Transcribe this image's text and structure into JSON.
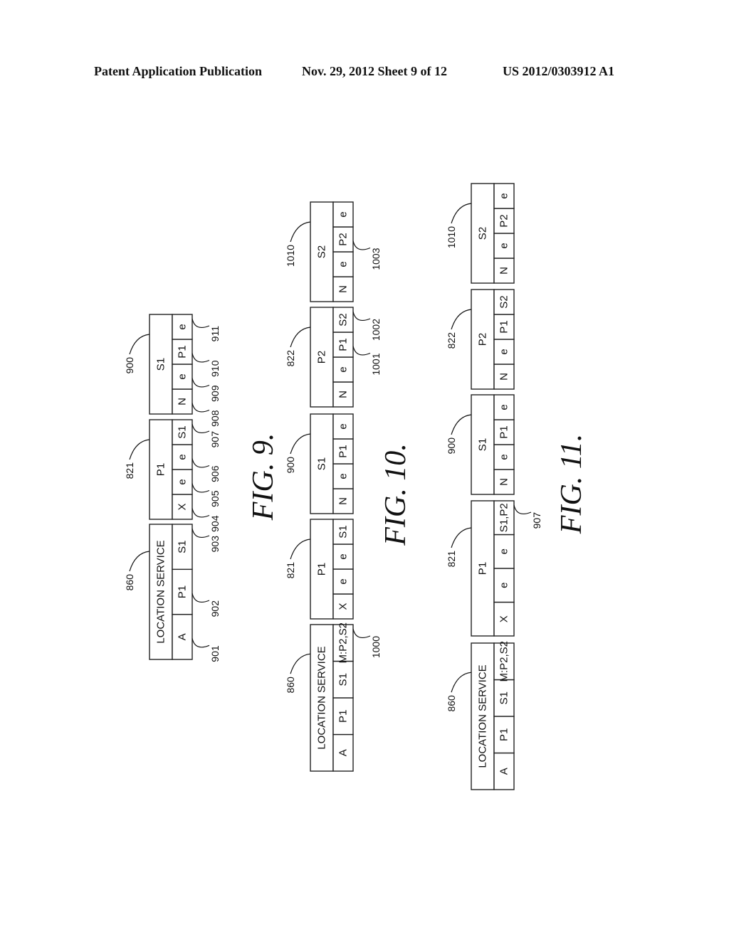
{
  "header": {
    "left": "Patent Application Publication",
    "middle": "Nov. 29, 2012   Sheet 9 of 12",
    "right": "US 2012/0303912 A1"
  },
  "figures": [
    {
      "caption": "FIG. 9.",
      "tables": [
        {
          "ref": "860",
          "title": "LOCATION SERVICE",
          "cells": [
            {
              "text": "A",
              "ref": "901"
            },
            {
              "text": "P1",
              "ref": "902"
            },
            {
              "text": "S1",
              "ref": "903"
            }
          ]
        },
        {
          "ref": "821",
          "title": "P1",
          "cells": [
            {
              "text": "X",
              "ref": "904"
            },
            {
              "text": "e",
              "ref": "905"
            },
            {
              "text": "e",
              "ref": "906"
            },
            {
              "text": "S1",
              "ref": "907"
            }
          ]
        },
        {
          "ref": "900",
          "title": "S1",
          "cells": [
            {
              "text": "N",
              "ref": "908"
            },
            {
              "text": "e",
              "ref": "909"
            },
            {
              "text": "P1",
              "ref": "910"
            },
            {
              "text": "e",
              "ref": "911"
            }
          ]
        }
      ]
    },
    {
      "caption": "FIG. 10.",
      "tables": [
        {
          "ref": "860",
          "title": "LOCATION SERVICE",
          "cells": [
            {
              "text": "A",
              "ref": ""
            },
            {
              "text": "P1",
              "ref": ""
            },
            {
              "text": "S1",
              "ref": ""
            },
            {
              "text": "M:P2,S2",
              "ref": "1000"
            }
          ]
        },
        {
          "ref": "821",
          "title": "P1",
          "cells": [
            {
              "text": "X",
              "ref": ""
            },
            {
              "text": "e",
              "ref": ""
            },
            {
              "text": "e",
              "ref": ""
            },
            {
              "text": "S1",
              "ref": ""
            }
          ]
        },
        {
          "ref": "900",
          "title": "S1",
          "cells": [
            {
              "text": "N",
              "ref": ""
            },
            {
              "text": "e",
              "ref": ""
            },
            {
              "text": "P1",
              "ref": ""
            },
            {
              "text": "e",
              "ref": ""
            }
          ]
        },
        {
          "ref": "822",
          "title": "P2",
          "cells": [
            {
              "text": "N",
              "ref": ""
            },
            {
              "text": "e",
              "ref": ""
            },
            {
              "text": "P1",
              "ref": "1001"
            },
            {
              "text": "S2",
              "ref": "1002"
            }
          ]
        },
        {
          "ref": "1010",
          "title": "S2",
          "cells": [
            {
              "text": "N",
              "ref": ""
            },
            {
              "text": "e",
              "ref": ""
            },
            {
              "text": "P2",
              "ref": "1003"
            },
            {
              "text": "e",
              "ref": ""
            }
          ]
        }
      ]
    },
    {
      "caption": "FIG. 11.",
      "tables": [
        {
          "ref": "860",
          "title": "LOCATION SERVICE",
          "cells": [
            {
              "text": "A",
              "ref": ""
            },
            {
              "text": "P1",
              "ref": ""
            },
            {
              "text": "S1",
              "ref": ""
            },
            {
              "text": "M:P2,S2",
              "ref": ""
            }
          ]
        },
        {
          "ref": "821",
          "title": "P1",
          "cells": [
            {
              "text": "X",
              "ref": ""
            },
            {
              "text": "e",
              "ref": ""
            },
            {
              "text": "e",
              "ref": ""
            },
            {
              "text": "S1,P2",
              "ref": "907"
            }
          ]
        },
        {
          "ref": "900",
          "title": "S1",
          "cells": [
            {
              "text": "N",
              "ref": ""
            },
            {
              "text": "e",
              "ref": ""
            },
            {
              "text": "P1",
              "ref": ""
            },
            {
              "text": "e",
              "ref": ""
            }
          ]
        },
        {
          "ref": "822",
          "title": "P2",
          "cells": [
            {
              "text": "N",
              "ref": ""
            },
            {
              "text": "e",
              "ref": ""
            },
            {
              "text": "P1",
              "ref": ""
            },
            {
              "text": "S2",
              "ref": ""
            }
          ]
        },
        {
          "ref": "1010",
          "title": "S2",
          "cells": [
            {
              "text": "N",
              "ref": ""
            },
            {
              "text": "e",
              "ref": ""
            },
            {
              "text": "P2",
              "ref": ""
            },
            {
              "text": "e",
              "ref": ""
            }
          ]
        }
      ]
    }
  ]
}
